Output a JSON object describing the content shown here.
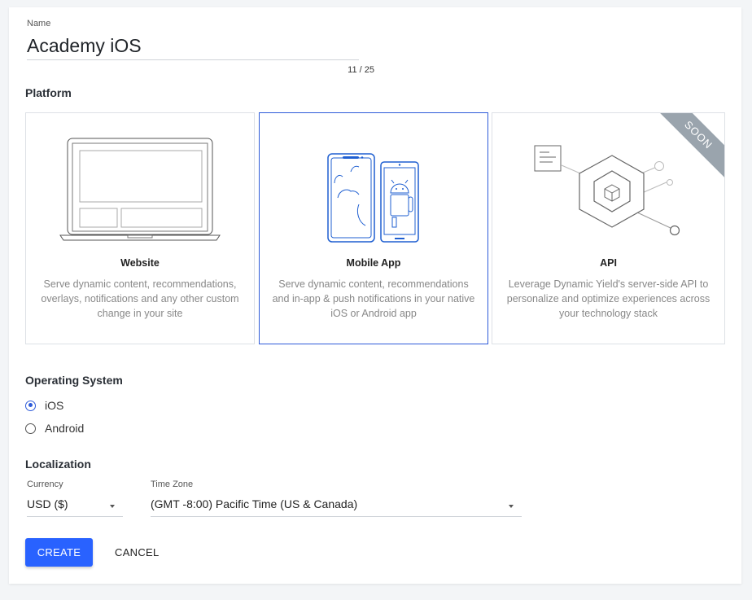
{
  "name": {
    "label": "Name",
    "value": "Academy iOS",
    "counter": "11 / 25"
  },
  "platform": {
    "title": "Platform",
    "cards": [
      {
        "title": "Website",
        "desc": "Serve dynamic content, recommendations, overlays, notifications and any other custom change in your site",
        "icon": "laptop-icon"
      },
      {
        "title": "Mobile App",
        "desc": "Serve dynamic content, recommendations and in-app & push notifications in your native iOS or Android app",
        "icon": "mobile-phones-icon",
        "selected": true
      },
      {
        "title": "API",
        "desc": "Leverage Dynamic Yield's server-side API to personalize and optimize experiences across your technology stack",
        "icon": "api-hexagon-icon",
        "badge": "SOON"
      }
    ]
  },
  "os": {
    "title": "Operating System",
    "options": [
      {
        "label": "iOS",
        "checked": true
      },
      {
        "label": "Android",
        "checked": false
      }
    ]
  },
  "localization": {
    "title": "Localization",
    "currency": {
      "label": "Currency",
      "value": "USD ($)"
    },
    "timezone": {
      "label": "Time Zone",
      "value": "(GMT -8:00) Pacific Time (US & Canada)"
    }
  },
  "actions": {
    "create": "CREATE",
    "cancel": "CANCEL"
  },
  "colors": {
    "accent": "#2962ff",
    "selected_border": "#2e5bd9",
    "illustration": "#1f5fd1",
    "badge": "#9aa4ad"
  }
}
